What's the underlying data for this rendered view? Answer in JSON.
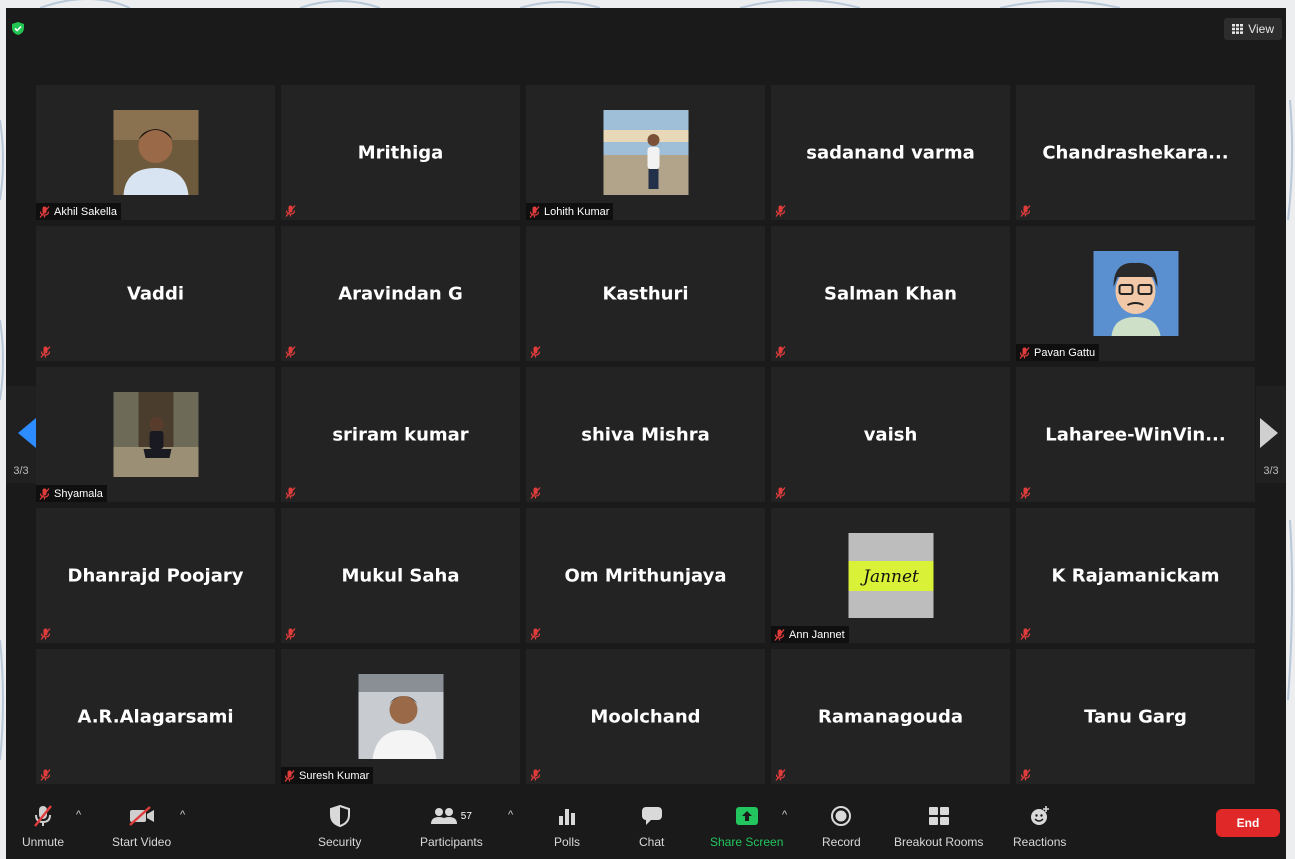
{
  "header": {
    "view_label": "View"
  },
  "participants": [
    {
      "name": "",
      "label": "Akhil Sakella",
      "photo": "person-photo"
    },
    {
      "name": "Mrithiga",
      "label": ""
    },
    {
      "name": "",
      "label": "Lohith Kumar",
      "photo": "beach-photo"
    },
    {
      "name": "sadanand varma",
      "label": ""
    },
    {
      "name": "Chandrashekara...",
      "label": ""
    },
    {
      "name": "Vaddi",
      "label": ""
    },
    {
      "name": "Aravindan G",
      "label": ""
    },
    {
      "name": "Kasthuri",
      "label": ""
    },
    {
      "name": "Salman Khan",
      "label": ""
    },
    {
      "name": "",
      "label": "Pavan Gattu",
      "photo": "cartoon-avatar"
    },
    {
      "name": "",
      "label": "Shyamala",
      "photo": "tree-photo"
    },
    {
      "name": "sriram kumar",
      "label": ""
    },
    {
      "name": "shiva Mishra",
      "label": ""
    },
    {
      "name": "vaish",
      "label": ""
    },
    {
      "name": "Laharee-WinVin...",
      "label": ""
    },
    {
      "name": "Dhanrajd Poojary",
      "label": ""
    },
    {
      "name": "Mukul Saha",
      "label": ""
    },
    {
      "name": "Om Mrithunjaya",
      "label": ""
    },
    {
      "name": "",
      "label": "Ann Jannet",
      "photo": "jannet-card",
      "photo_text": "Jannet"
    },
    {
      "name": "K Rajamanickam",
      "label": ""
    },
    {
      "name": "A.R.Alagarsami",
      "label": ""
    },
    {
      "name": "",
      "label": "Suresh Kumar",
      "photo": "selfie-photo"
    },
    {
      "name": "Moolchand",
      "label": ""
    },
    {
      "name": "Ramanagouda",
      "label": ""
    },
    {
      "name": "Tanu Garg",
      "label": ""
    }
  ],
  "nav": {
    "prev_page": "3/3",
    "next_page": "3/3"
  },
  "toolbar": {
    "unmute": "Unmute",
    "start_video": "Start Video",
    "security": "Security",
    "participants": "Participants",
    "participants_count": "57",
    "polls": "Polls",
    "chat": "Chat",
    "share_screen": "Share Screen",
    "record": "Record",
    "breakout_rooms": "Breakout Rooms",
    "reactions": "Reactions",
    "end": "End"
  },
  "colors": {
    "accent_blue": "#2d8cff",
    "share_green": "#22c55e",
    "end_red": "#e02828",
    "muted_red": "#e03c3c"
  }
}
